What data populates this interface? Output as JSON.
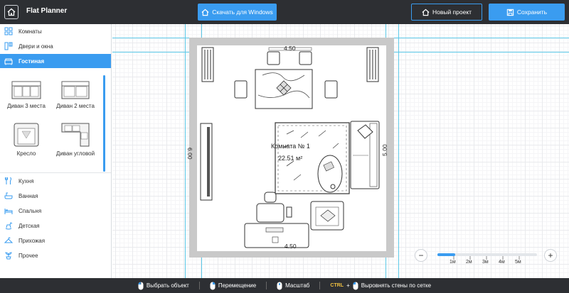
{
  "header": {
    "brand": "Flat Planner",
    "download_label": "Скачать для Windows",
    "new_project_label": "Новый проект",
    "save_label": "Сохранить"
  },
  "sidebar": {
    "items_top": [
      {
        "label": "Комнаты",
        "icon": "rooms-grid-icon"
      },
      {
        "label": "Двери и окна",
        "icon": "door-window-icon"
      },
      {
        "label": "Гостиная",
        "icon": "sofa-icon",
        "active": true
      }
    ],
    "furniture": [
      {
        "label": "Диван 3 места"
      },
      {
        "label": "Диван 2 места"
      },
      {
        "label": "Кресло"
      },
      {
        "label": "Диван угловой"
      }
    ],
    "items_bottom": [
      {
        "label": "Кухня",
        "icon": "kitchen-icon"
      },
      {
        "label": "Ванная",
        "icon": "bath-icon"
      },
      {
        "label": "Спальня",
        "icon": "bed-icon"
      },
      {
        "label": "Детская",
        "icon": "toy-horse-icon"
      },
      {
        "label": "Прихожая",
        "icon": "hanger-icon"
      },
      {
        "label": "Прочее",
        "icon": "plant-icon"
      }
    ]
  },
  "plan": {
    "dim_top": "4.50",
    "dim_bottom": "4.50",
    "dim_left": "6.00",
    "dim_right": "5.00",
    "room_name": "Комната № 1",
    "room_area": "22.51 м²"
  },
  "zoom": {
    "minus": "−",
    "plus": "+",
    "ticks": [
      "1м",
      "2м",
      "3м",
      "4м",
      "5м"
    ],
    "level": 0.18
  },
  "footer": {
    "select": "Выбрать объект",
    "move": "Перемещение",
    "scale": "Масштаб",
    "ctrl": "CTRL",
    "plus": "+",
    "align": "Выровнять стены по сетке"
  },
  "colors": {
    "accent": "#3a9cf0",
    "dark": "#2d2f33",
    "guide": "#5cc9e8"
  }
}
